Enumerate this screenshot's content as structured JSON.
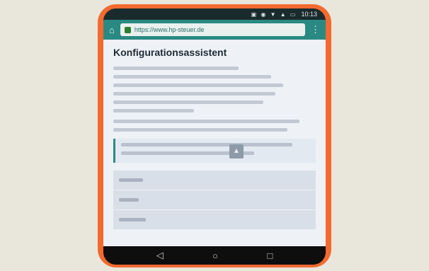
{
  "status_bar": {
    "time": "10:13",
    "icons": [
      "notification-icon",
      "wifi-icon",
      "signal-icon",
      "battery-icon"
    ]
  },
  "browser": {
    "url": "https://www.hp-steuer.de"
  },
  "page": {
    "title": "Konfigurationsassistent"
  },
  "colors": {
    "phone_body": "#f26a2f",
    "url_bar": "#2a8a83",
    "page_background": "#eef1f6"
  }
}
